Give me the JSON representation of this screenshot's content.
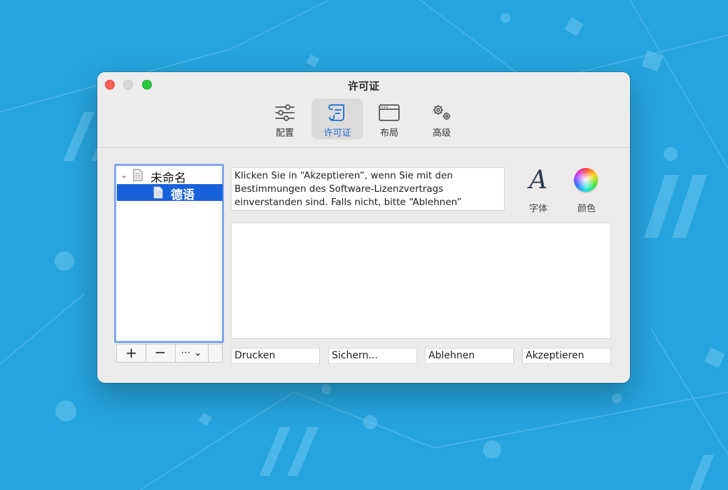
{
  "window": {
    "title": "许可证"
  },
  "toolbar": {
    "items": [
      {
        "label": "配置",
        "icon": "sliders-icon"
      },
      {
        "label": "许可证",
        "icon": "license-scroll-icon",
        "active": true
      },
      {
        "label": "布局",
        "icon": "window-layout-icon"
      },
      {
        "label": "高级",
        "icon": "gears-icon"
      }
    ]
  },
  "sidebar": {
    "root_label": "未命名",
    "child_label": "德语",
    "buttons": {
      "add": "+",
      "remove": "−",
      "more": "⋯ ⌄"
    }
  },
  "message": {
    "lines": [
      "Klicken Sie in “Akzeptieren”, wenn Sie mit den",
      "Bestimmungen des Software-Lizenzvertrags",
      "einverstanden sind. Falls nicht, bitte “Ablehnen”"
    ]
  },
  "style_buttons": {
    "font_label": "字体",
    "font_glyph": "A",
    "color_label": "颜色"
  },
  "license_text": "",
  "actions": {
    "print": "Drucken",
    "save": "Sichern...",
    "decline": "Ablehnen",
    "accept": "Akzeptieren"
  },
  "colors": {
    "accent": "#1761da",
    "background": "#26a4de",
    "window": "#ecebea"
  }
}
